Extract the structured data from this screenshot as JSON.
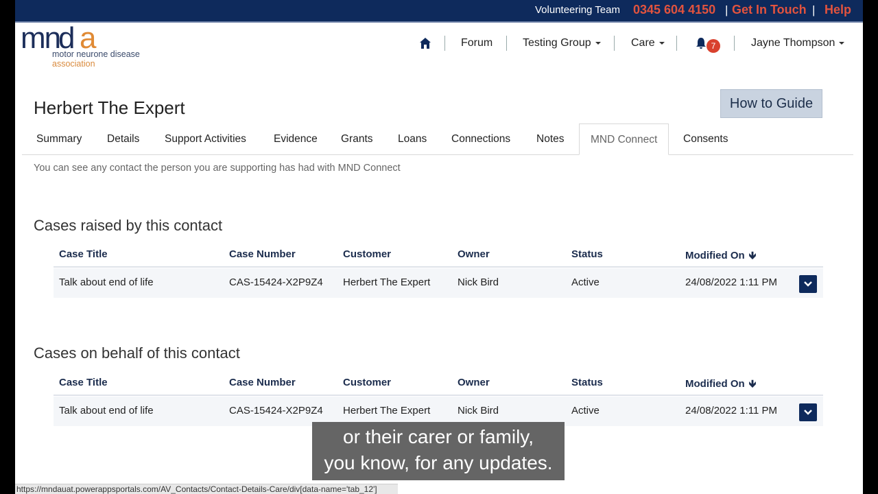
{
  "topbar": {
    "team": "Volunteering Team",
    "phone": "0345 604 4150",
    "sep": "|",
    "get_in_touch": "Get In Touch",
    "help": "Help"
  },
  "logo": {
    "mark": "mnda",
    "line1": "motor neurone disease",
    "line2": "association"
  },
  "nav": {
    "home_icon": "home-icon",
    "forum": "Forum",
    "testing_group": "Testing Group",
    "care": "Care",
    "bell_icon": "bell-icon",
    "notifications": "7",
    "user": "Jayne Thompson"
  },
  "page": {
    "title": "Herbert The Expert",
    "guide_button": "How to Guide",
    "intro": "You can see any contact the person you are supporting has had with MND Connect"
  },
  "tabs": [
    {
      "label": "Summary"
    },
    {
      "label": "Details"
    },
    {
      "label": "Support Activities"
    },
    {
      "label": "Evidence"
    },
    {
      "label": "Grants"
    },
    {
      "label": "Loans"
    },
    {
      "label": "Connections"
    },
    {
      "label": "Notes"
    },
    {
      "label": "MND Connect",
      "active": true
    },
    {
      "label": "Consents"
    }
  ],
  "columns": [
    "Case Title",
    "Case Number",
    "Customer",
    "Owner",
    "Status",
    "Modified On"
  ],
  "sections": [
    {
      "title": "Cases raised by this contact",
      "rows": [
        {
          "case_title": "Talk about end of life",
          "case_number": "CAS-15424-X2P9Z4",
          "customer": "Herbert The Expert",
          "owner": "Nick Bird",
          "status": "Active",
          "modified_on": "24/08/2022 1:11 PM"
        }
      ]
    },
    {
      "title": "Cases on behalf of this contact",
      "rows": [
        {
          "case_title": "Talk about end of life",
          "case_number": "CAS-15424-X2P9Z4",
          "customer": "Herbert The Expert",
          "owner": "Nick Bird",
          "status": "Active",
          "modified_on": "24/08/2022 1:11 PM"
        }
      ]
    }
  ],
  "subtitle": {
    "line1": "or their carer or family,",
    "line2": "you know, for any updates."
  },
  "statusbar": "https://mndauat.powerappsportals.com/AV_Contacts/Contact-Details-Care/div[data-name='tab_12']",
  "colors": {
    "topbar": "#0e2a5c",
    "accent_red": "#e2533e",
    "header_text": "#1b2c4d",
    "row_button": "#0e2a5c"
  }
}
